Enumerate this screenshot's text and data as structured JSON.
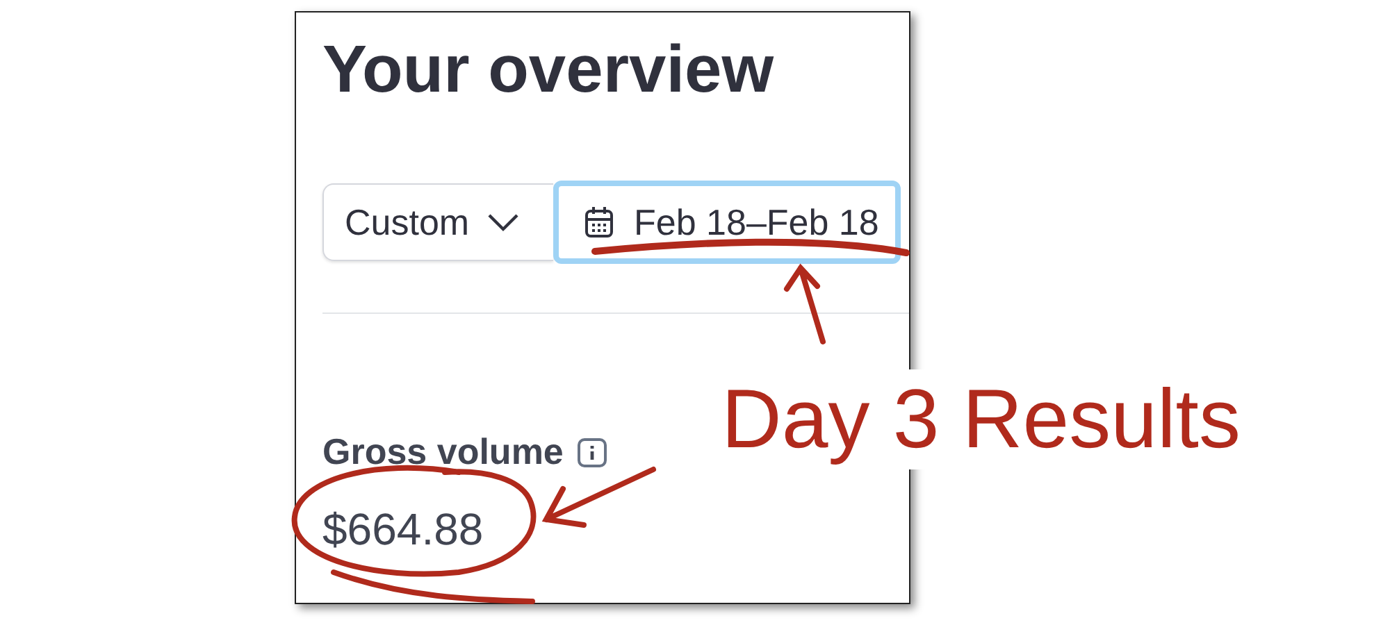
{
  "heading": "Your overview",
  "filters": {
    "range_select": {
      "value": "Custom"
    },
    "date_button": {
      "label": "Feb 18–Feb 18",
      "focused": true
    }
  },
  "metric": {
    "label": "Gross volume",
    "value": "$664.88"
  },
  "annotation": {
    "text": "Day 3 Results"
  }
}
